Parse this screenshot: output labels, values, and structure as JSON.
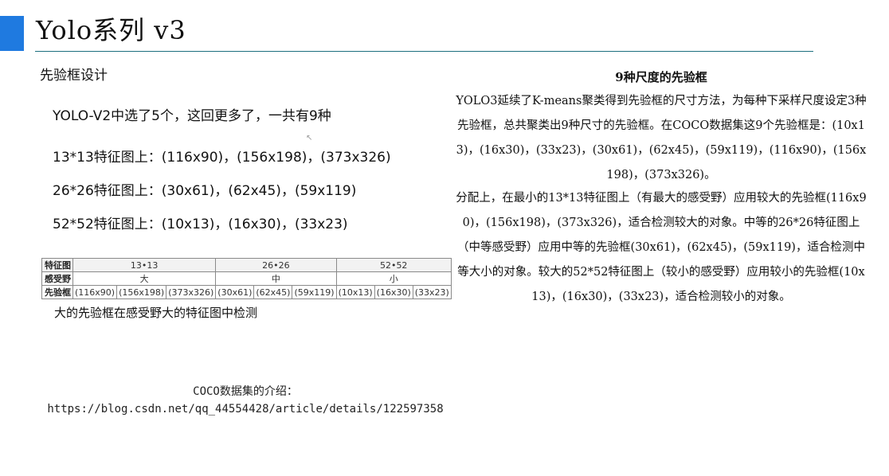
{
  "slide": {
    "title": "Yolo系列 v3",
    "accent_color": "#1f7ae0",
    "rule_color": "#1c6f7e"
  },
  "left": {
    "heading": "先验框设计",
    "bullets": [
      "YOLO-V2中选了5个，这回更多了，一共有9种",
      "13*13特征图上：(116x90)，(156x198)，(373x326)",
      "26*26特征图上：(30x61)，(62x45)，(59x119)",
      "52*52特征图上：(10x13)，(16x30)，(33x23)"
    ],
    "table": {
      "row1": {
        "label": "特征图",
        "groups": [
          "13•13",
          "26•26",
          "52•52"
        ]
      },
      "row2": {
        "label": "感受野",
        "groups": [
          "大",
          "中",
          "小"
        ]
      },
      "row3": {
        "label": "先验框",
        "cells": [
          "(116x90)",
          "(156x198)",
          "(373x326)",
          "(30x61)",
          "(62x45)",
          "(59x119)",
          "(10x13)",
          "(16x30)",
          "(33x23)"
        ]
      }
    },
    "caption": "大的先验框在感受野大的特征图中检测"
  },
  "coco": {
    "label": "COCO数据集的介绍：",
    "link": "https://blog.csdn.net/qq_44554428/article/details/122597358"
  },
  "right": {
    "heading": "9种尺度的先验框",
    "paragraph1": "YOLO3延续了K-means聚类得到先验框的尺寸方法，为每种下采样尺度设定3种先验框，总共聚类出9种尺寸的先验框。在COCO数据集这9个先验框是：(10x13)，(16x30)，(33x23)，(30x61)，(62x45)，(59x119)，(116x90)，(156x198)，(373x326)。",
    "paragraph2": "分配上，在最小的13*13特征图上（有最大的感受野）应用较大的先验框(116x90)，(156x198)，(373x326)，适合检测较大的对象。中等的26*26特征图上（中等感受野）应用中等的先验框(30x61)，(62x45)，(59x119)，适合检测中等大小的对象。较大的52*52特征图上（较小的感受野）应用较小的先验框(10x13)，(16x30)，(33x23)，适合检测较小的对象。"
  }
}
